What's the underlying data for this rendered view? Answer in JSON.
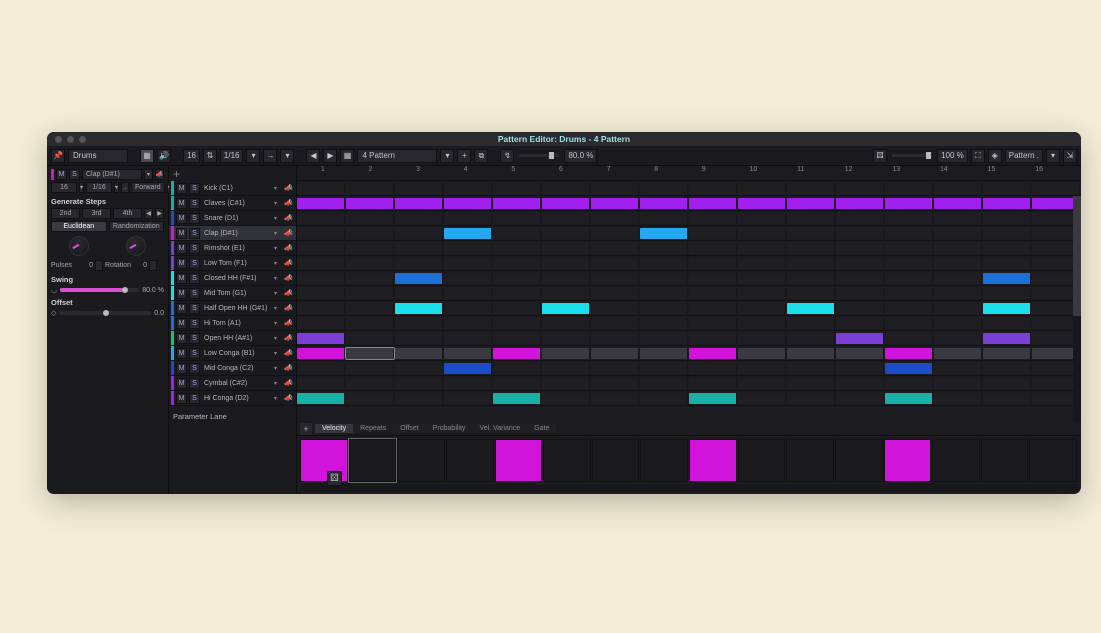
{
  "window": {
    "title": "Pattern Editor: Drums - 4 Pattern"
  },
  "toolbar": {
    "track_name": "Drums",
    "steps": "16",
    "resolution": "1/16",
    "pattern_sel": "4 Pattern",
    "swing": "80.0 %",
    "zoom": "100 %",
    "view_menu": "Pattern ."
  },
  "left": {
    "active_lane": "Clap (D#1)",
    "step_count": "16",
    "step_res": "1/16",
    "play_dir": "Forward",
    "section": "Generate Steps",
    "nth": [
      "2nd",
      "3rd",
      "4th"
    ],
    "modes": [
      "Euclidean",
      "Randomization"
    ],
    "pulses_label": "Pulses",
    "pulses": "0",
    "rotation_label": "Rotation",
    "rotation": "0",
    "swing_label": "Swing",
    "swing_val": "80.0 %",
    "offset_label": "Offset",
    "offset_val": "0.0"
  },
  "lanes": [
    {
      "name": "Kick (C1)",
      "color": "#17b0a6"
    },
    {
      "name": "Claves (C#1)",
      "color": "#17b0a6"
    },
    {
      "name": "Snare (D1)",
      "color": "#1b4ec8"
    },
    {
      "name": "Clap (D#1)",
      "color": "#d213db",
      "selected": true
    },
    {
      "name": "Rimshot (E1)",
      "color": "#7b3fd6"
    },
    {
      "name": "Low Tom (F1)",
      "color": "#7b3fd6"
    },
    {
      "name": "Closed HH (F#1)",
      "color": "#19e0e8"
    },
    {
      "name": "Mid Tom (G1)",
      "color": "#19e0e8"
    },
    {
      "name": "Half Open HH (G#1)",
      "color": "#1b71d8"
    },
    {
      "name": "Hi Tom (A1)",
      "color": "#1b71d8"
    },
    {
      "name": "Open HH (A#1)",
      "color": "#20c060"
    },
    {
      "name": "Low Conga (B1)",
      "color": "#26a8f0"
    },
    {
      "name": "Mid Conga (C2)",
      "color": "#1b4ec8"
    },
    {
      "name": "Cymbal (C#2)",
      "color": "#a020f0"
    },
    {
      "name": "Hi Conga (D2)",
      "color": "#a020f0"
    }
  ],
  "parameter_lane_label": "Parameter Lane",
  "vel_tabs": [
    "Velocity",
    "Repeats",
    "Offset",
    "Probability",
    "Vel. Variance",
    "Gate"
  ],
  "ruler": [
    "1",
    "2",
    "3",
    "4",
    "5",
    "6",
    "7",
    "8",
    "9",
    "10",
    "11",
    "12",
    "13",
    "14",
    "15",
    "16"
  ],
  "pattern": {
    "0": {
      "steps": [
        0,
        4,
        8,
        12
      ],
      "c": "#17b0a6"
    },
    "2": {
      "steps": [
        3,
        12
      ],
      "c": "#1b4ec8"
    },
    "3": {
      "steps": [
        0,
        4,
        8,
        12
      ],
      "c": "#d213db",
      "fill": [
        1,
        2,
        3,
        5,
        6,
        7,
        9,
        10,
        11,
        13,
        14,
        15
      ],
      "fc": "#3a3a42"
    },
    "4": {
      "steps": [
        0,
        11,
        14
      ],
      "c": "#7b3fd6"
    },
    "6": {
      "steps": [
        2,
        5,
        10,
        14
      ],
      "c": "#19e0e8"
    },
    "8": {
      "steps": [
        2,
        14
      ],
      "c": "#1b71d8"
    },
    "11": {
      "steps": [
        3,
        7
      ],
      "c": "#26a8f0"
    },
    "13": {
      "steps": [
        0,
        1,
        2,
        3,
        4,
        5,
        6,
        7,
        8,
        9,
        10,
        11,
        12,
        13,
        14,
        15
      ],
      "c": "#a020f0"
    }
  },
  "velocity": [
    100,
    0,
    0,
    0,
    100,
    0,
    0,
    0,
    100,
    0,
    0,
    0,
    100,
    0,
    0,
    0
  ]
}
